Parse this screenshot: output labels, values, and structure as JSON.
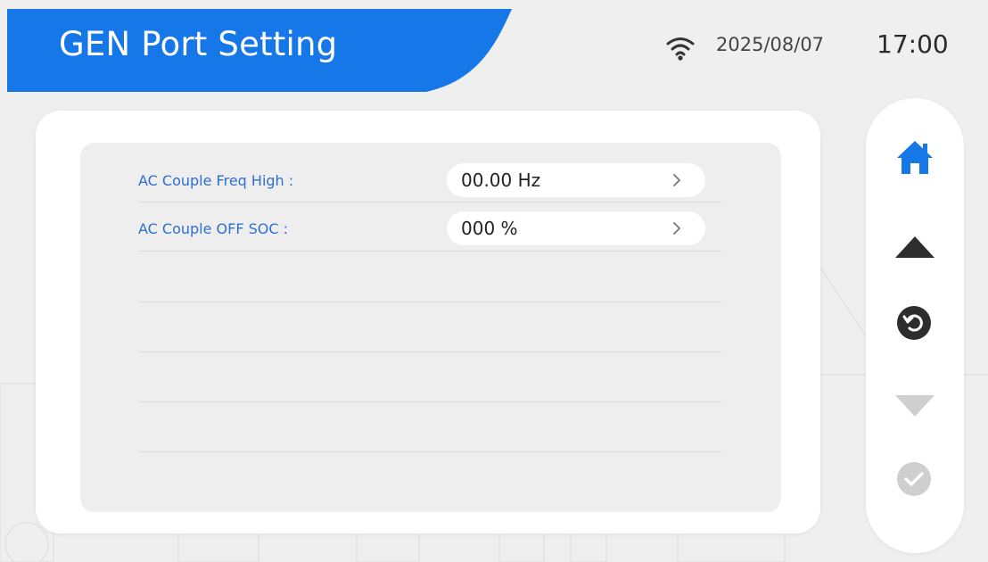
{
  "header": {
    "title": "GEN Port Setting",
    "date": "2025/08/07",
    "time": "17:00",
    "wifi_icon": "wifi-icon"
  },
  "settings": [
    {
      "label": "AC Couple Freq High :",
      "value": "00.00 Hz"
    },
    {
      "label": "AC Couple OFF SOC :",
      "value": "000 %"
    }
  ],
  "nav": {
    "home_icon": "home-icon",
    "up_icon": "arrow-up-icon",
    "back_icon": "return-icon",
    "down_icon": "arrow-down-icon",
    "confirm_icon": "check-icon"
  },
  "colors": {
    "accent": "#1677e8",
    "label": "#2e6fd1",
    "icon_dark": "#2d2d2d",
    "icon_disabled": "#cfcfcf"
  }
}
